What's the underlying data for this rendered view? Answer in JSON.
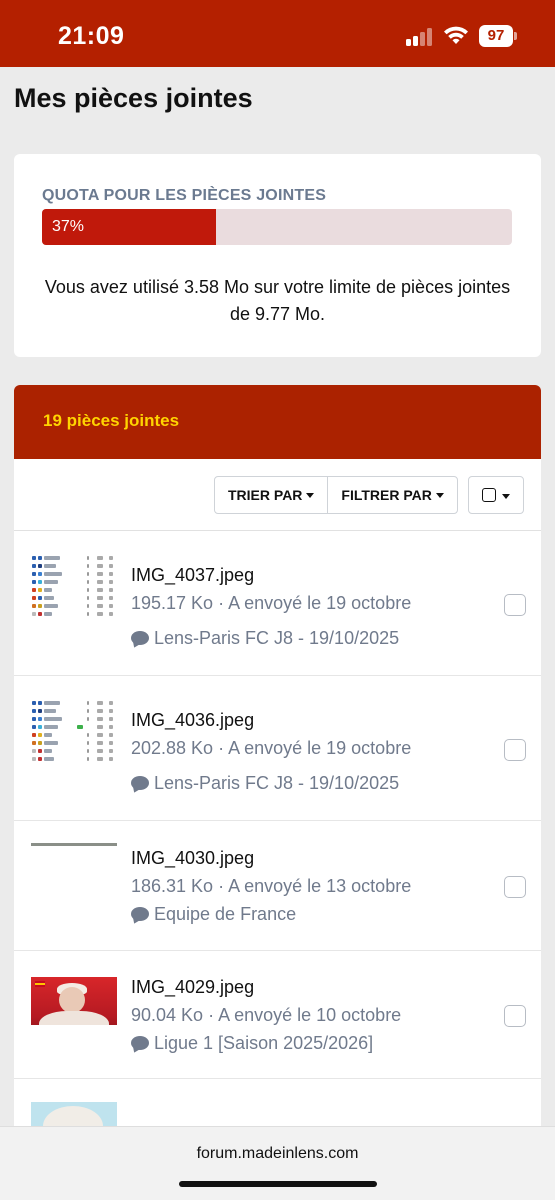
{
  "status_bar": {
    "time": "21:09",
    "battery": "97",
    "icons": [
      "cellular-signal-icon",
      "wifi-icon",
      "battery-icon"
    ]
  },
  "page": {
    "title": "Mes pièces jointes"
  },
  "quota": {
    "label": "QUOTA POUR LES PIÈCES JOINTES",
    "percent_label": "37%",
    "percent_value": 37,
    "usage_text": "Vous avez utilisé 3.58 Mo sur votre limite de pièces jointes de 9.77 Mo."
  },
  "attachments": {
    "count_label": "19 pièces jointes",
    "sort_label": "TRIER PAR",
    "filter_label": "FILTRER PAR",
    "items": [
      {
        "filename": "IMG_4037.jpeg",
        "meta": "195.17 Ko · A envoyé le 19 octobre",
        "topic": "Lens-Paris FC J8 - 19/10/2025"
      },
      {
        "filename": "IMG_4036.jpeg",
        "meta": "202.88 Ko · A envoyé le 19 octobre",
        "topic": "Lens-Paris FC J8 - 19/10/2025"
      },
      {
        "filename": "IMG_4030.jpeg",
        "meta": "186.31 Ko · A envoyé le 13 octobre",
        "topic": "Equipe de France"
      },
      {
        "filename": "IMG_4029.jpeg",
        "meta": "90.04 Ko · A envoyé le 10 octobre",
        "topic": "Ligue 1 [Saison 2025/2026]"
      }
    ]
  },
  "browser": {
    "url": "forum.madeinlens.com"
  },
  "colors": {
    "brand_red": "#b42000",
    "header_red": "#ab2200",
    "count_yellow": "#ffd400",
    "quota_fill": "#c0190b",
    "muted_text": "#707a8c"
  }
}
